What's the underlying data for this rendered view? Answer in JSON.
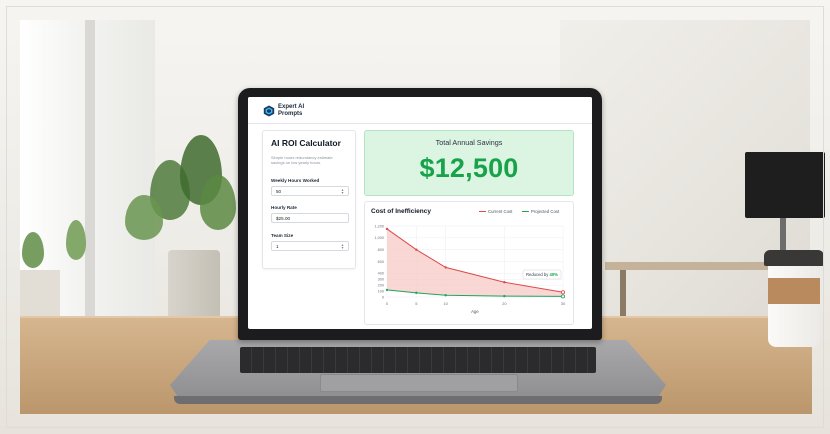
{
  "brand": {
    "name": "Expert AI Prompts",
    "accent": "#18a34a"
  },
  "calculator": {
    "title": "AI ROI Calculator",
    "description": "Simple hours redundancy estimate savings on low yearly hours.",
    "fields": [
      {
        "label": "Weekly Hours Worked",
        "value": "50"
      },
      {
        "label": "Hourly Rate",
        "value": "$25.00"
      },
      {
        "label": "Team Size",
        "value": "1"
      }
    ]
  },
  "savings": {
    "label": "Total Annual Savings",
    "value": "$12,500"
  },
  "chart_data": {
    "type": "line",
    "title": "Cost of Inefficiency",
    "xlabel": "Age",
    "ylabel": "",
    "x": [
      0,
      5,
      10,
      20,
      30
    ],
    "x_ticks": [
      "0",
      "5",
      "10",
      "20",
      "30"
    ],
    "y_ticks": [
      "0",
      "100",
      "200",
      "300",
      "400",
      "600",
      "800",
      "1,000",
      "1,200"
    ],
    "ylim": [
      0,
      1200
    ],
    "series": [
      {
        "name": "Current Cost",
        "color": "#dc4a4a",
        "values": [
          1150,
          800,
          500,
          250,
          80
        ]
      },
      {
        "name": "Projected Cost",
        "color": "#22a35a",
        "values": [
          120,
          70,
          30,
          15,
          10
        ]
      }
    ],
    "annotation": {
      "prefix": "Reduced by ",
      "value": "40%"
    },
    "grid": true,
    "legend_position": "top-right"
  }
}
